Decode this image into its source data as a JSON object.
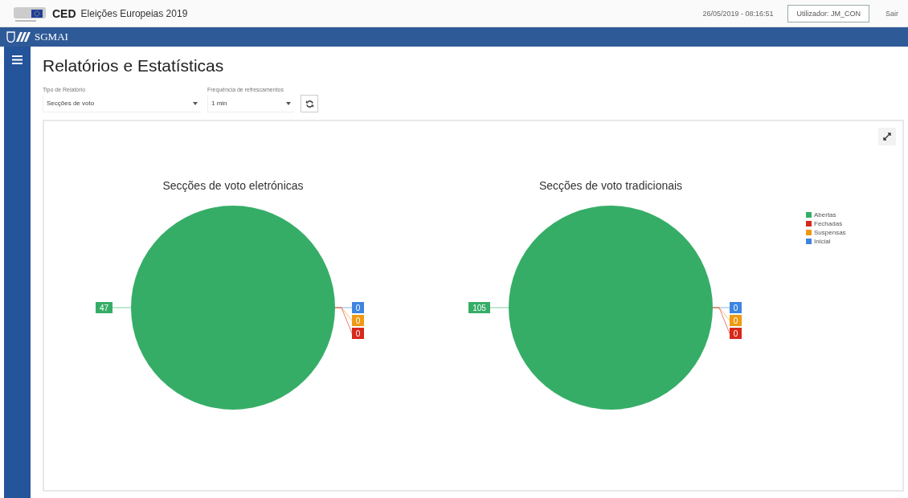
{
  "header": {
    "app_code": "CED",
    "app_title": "Eleições Europeias 2019",
    "datetime": "26/05/2019 - 08:16:51",
    "user_button": "Utilizador: JM_CON",
    "logout": "Sair"
  },
  "brand_bar": {
    "name": "SGMAI"
  },
  "page_title": "Relatórios e Estatísticas",
  "filters": [
    {
      "label": "Tipo de Relatório",
      "value": "Secções de voto"
    },
    {
      "label": "Frequência de refrescamentos",
      "value": "1 min"
    }
  ],
  "legend": [
    {
      "label": "Abertas",
      "color": "#36ad67"
    },
    {
      "label": "Fechadas",
      "color": "#d7281b"
    },
    {
      "label": "Suspensas",
      "color": "#ee9a12"
    },
    {
      "label": "Inicial",
      "color": "#3d85e0"
    }
  ],
  "charts": [
    {
      "chart_data": {
        "type": "pie",
        "title": "Secções de voto eletrónicas",
        "values": [
          47,
          0,
          0,
          0
        ],
        "value_labels": [
          "47",
          "0",
          "0",
          "0"
        ]
      }
    },
    {
      "chart_data": {
        "type": "pie",
        "title": "Secções de voto tradicionais",
        "values": [
          105,
          0,
          0,
          0
        ],
        "value_labels": [
          "105",
          "0",
          "0",
          "0"
        ]
      }
    }
  ]
}
